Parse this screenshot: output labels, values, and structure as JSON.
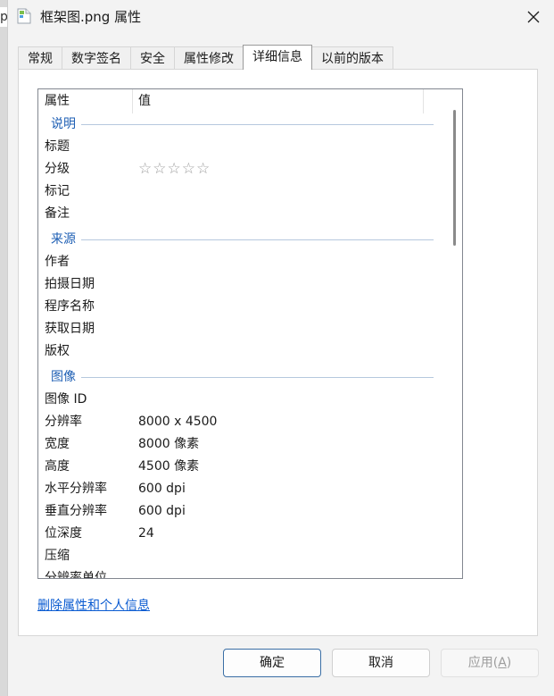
{
  "backdrop": {
    "fragment_text": "p"
  },
  "window": {
    "title": "框架图.png 属性",
    "icon": "image-file-icon",
    "close_icon": "close-icon"
  },
  "tabs": [
    {
      "label": "常规",
      "active": false
    },
    {
      "label": "数字签名",
      "active": false
    },
    {
      "label": "安全",
      "active": false
    },
    {
      "label": "属性修改",
      "active": false
    },
    {
      "label": "详细信息",
      "active": true
    },
    {
      "label": "以前的版本",
      "active": false
    }
  ],
  "details": {
    "columns": {
      "property": "属性",
      "value": "值"
    },
    "groups": [
      {
        "title": "说明",
        "rows": [
          {
            "name": "标题",
            "value": ""
          },
          {
            "name": "分级",
            "value": "",
            "rating_stars": 5,
            "rating_filled": 0
          },
          {
            "name": "标记",
            "value": ""
          },
          {
            "name": "备注",
            "value": ""
          }
        ]
      },
      {
        "title": "来源",
        "rows": [
          {
            "name": "作者",
            "value": ""
          },
          {
            "name": "拍摄日期",
            "value": ""
          },
          {
            "name": "程序名称",
            "value": ""
          },
          {
            "name": "获取日期",
            "value": ""
          },
          {
            "name": "版权",
            "value": ""
          }
        ]
      },
      {
        "title": "图像",
        "rows": [
          {
            "name": "图像 ID",
            "value": ""
          },
          {
            "name": "分辨率",
            "value": "8000 x 4500"
          },
          {
            "name": "宽度",
            "value": "8000 像素"
          },
          {
            "name": "高度",
            "value": "4500 像素"
          },
          {
            "name": "水平分辨率",
            "value": "600 dpi"
          },
          {
            "name": "垂直分辨率",
            "value": "600 dpi"
          },
          {
            "name": "位深度",
            "value": "24"
          },
          {
            "name": "压缩",
            "value": ""
          },
          {
            "name": "分辨率单位",
            "value": ""
          }
        ]
      }
    ]
  },
  "remove_link": "删除属性和个人信息",
  "buttons": {
    "ok": "确定",
    "cancel": "取消",
    "apply_label": "应用(",
    "apply_mnemonic": "A",
    "apply_close": ")"
  },
  "colors": {
    "group_header": "#1e5fb4",
    "link": "#0a5bd1",
    "star": "#a0a0a0"
  }
}
